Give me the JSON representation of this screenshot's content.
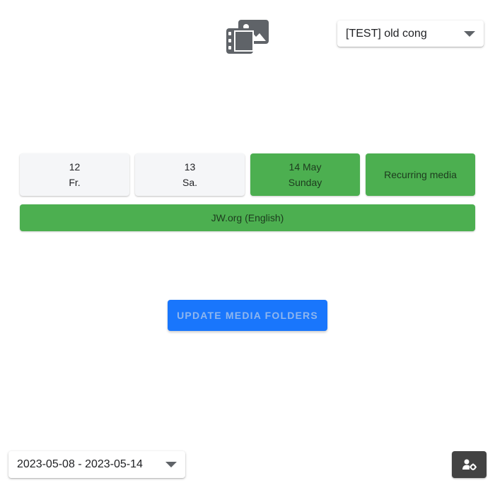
{
  "app": {
    "logo_icon": "media-folders-icon",
    "logo_color": "#5f6368"
  },
  "congregation_select": {
    "value": "[TEST] old cong",
    "icon": "caret-down-icon"
  },
  "days": [
    {
      "line1": "12",
      "line2": "Fr.",
      "state": "inactive"
    },
    {
      "line1": "13",
      "line2": "Sa.",
      "state": "inactive"
    },
    {
      "line1": "14 May",
      "line2": "Sunday",
      "state": "done"
    }
  ],
  "recurring": {
    "label": "Recurring media",
    "state": "done"
  },
  "jworg": {
    "label": "JW.org (English)",
    "state": "done"
  },
  "update_button": {
    "label": "UPDATE MEDIA FOLDERS"
  },
  "week_select": {
    "value": "2023-05-08 - 2023-05-14",
    "icon": "caret-down-icon"
  },
  "settings_button": {
    "icon": "user-cog-icon"
  },
  "colors": {
    "success": "#4caf50",
    "primary": "#1976fc",
    "dark": "#424242",
    "light": "#f5f6f8"
  }
}
